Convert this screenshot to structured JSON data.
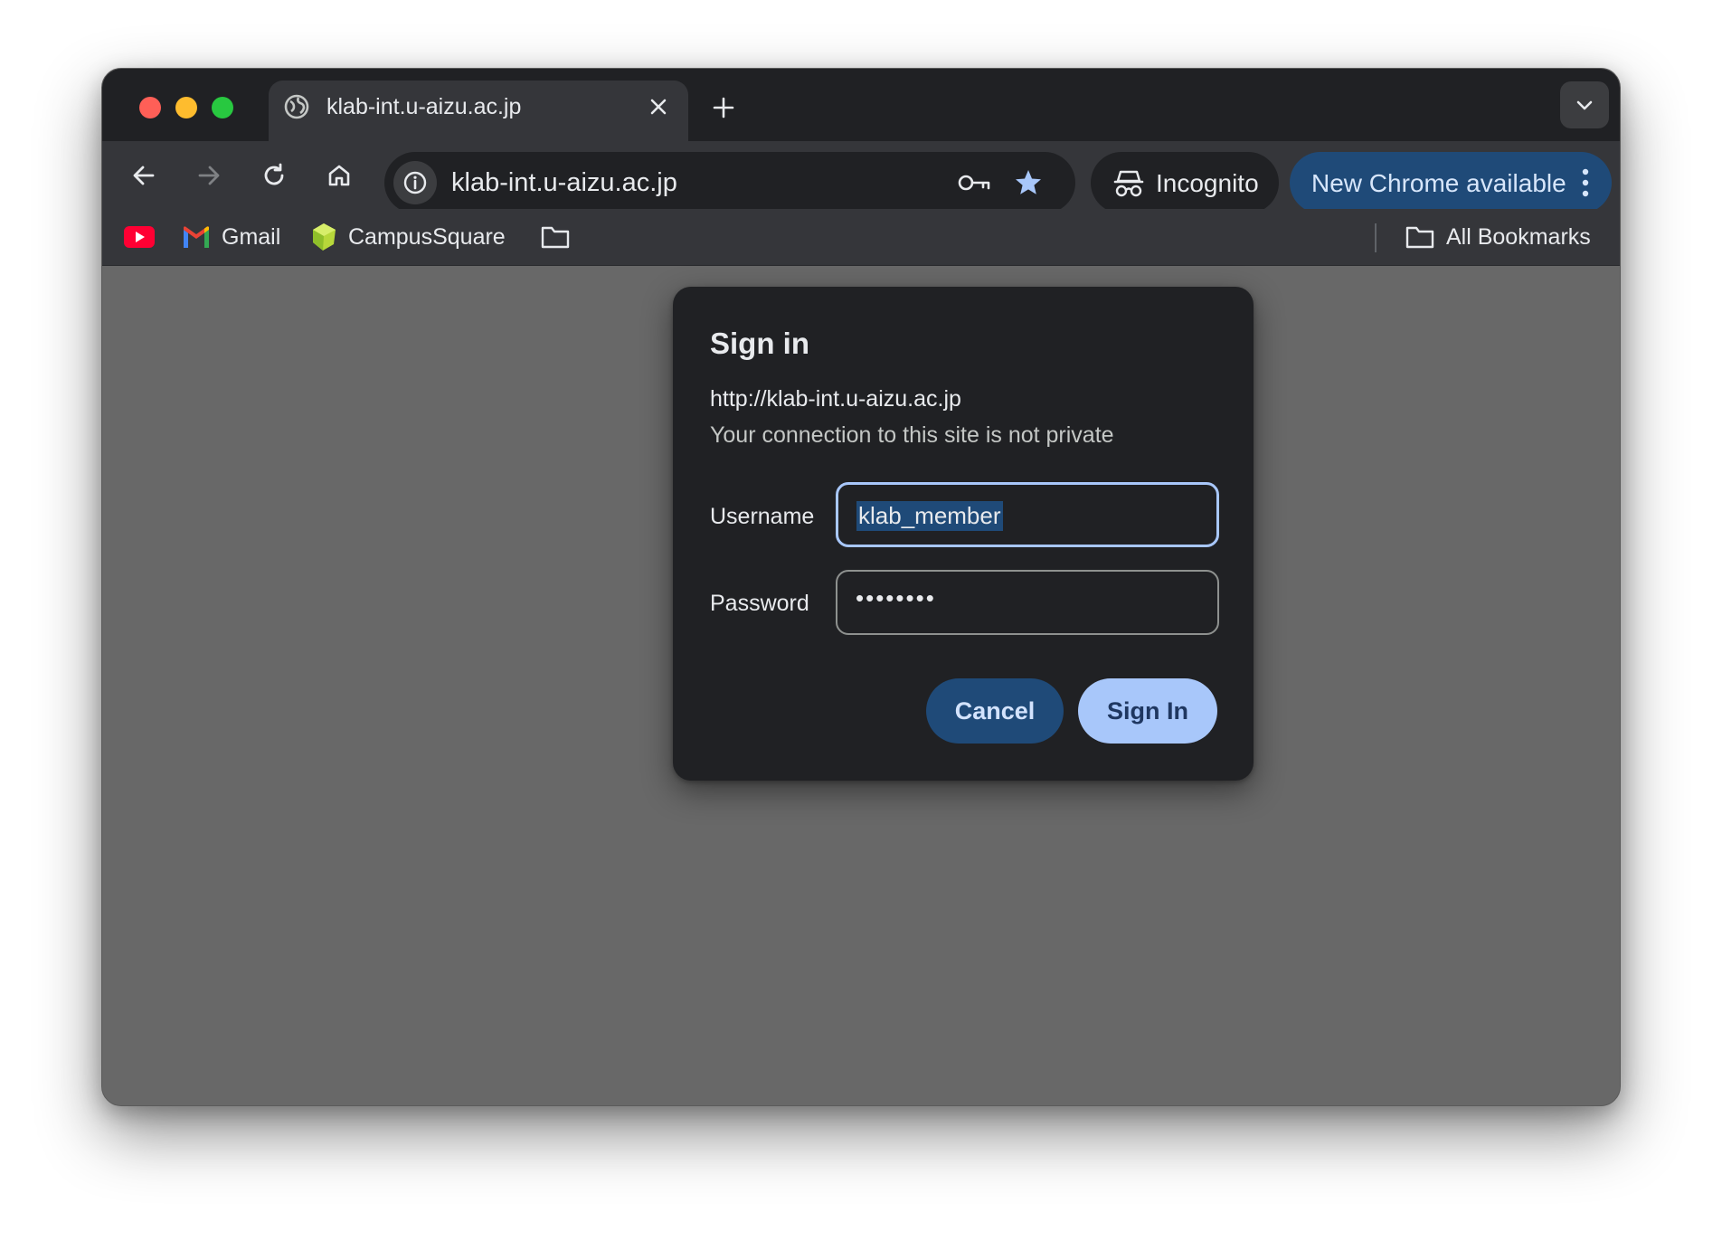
{
  "browser": {
    "tab": {
      "title": "klab-int.u-aizu.ac.jp"
    },
    "omnibox": {
      "url": "klab-int.u-aizu.ac.jp"
    },
    "incognito_label": "Incognito",
    "update_label": "New Chrome available",
    "bookmarks": {
      "items": [
        {
          "label": "",
          "icon": "youtube-icon"
        },
        {
          "label": "Gmail",
          "icon": "gmail-icon"
        },
        {
          "label": "CampusSquare",
          "icon": "campussquare-icon"
        },
        {
          "label": "",
          "icon": "folder-icon"
        }
      ],
      "all_bookmarks_label": "All Bookmarks"
    }
  },
  "dialog": {
    "title": "Sign in",
    "url": "http://klab-int.u-aizu.ac.jp",
    "warning": "Your connection to this site is not private",
    "username_label": "Username",
    "username_value": "klab_member",
    "password_label": "Password",
    "password_mask": "••••••••",
    "cancel_label": "Cancel",
    "signin_label": "Sign In"
  },
  "colors": {
    "accent": "#a8c7fa",
    "update_pill": "#1f4a78",
    "dialog_bg": "#202124"
  }
}
